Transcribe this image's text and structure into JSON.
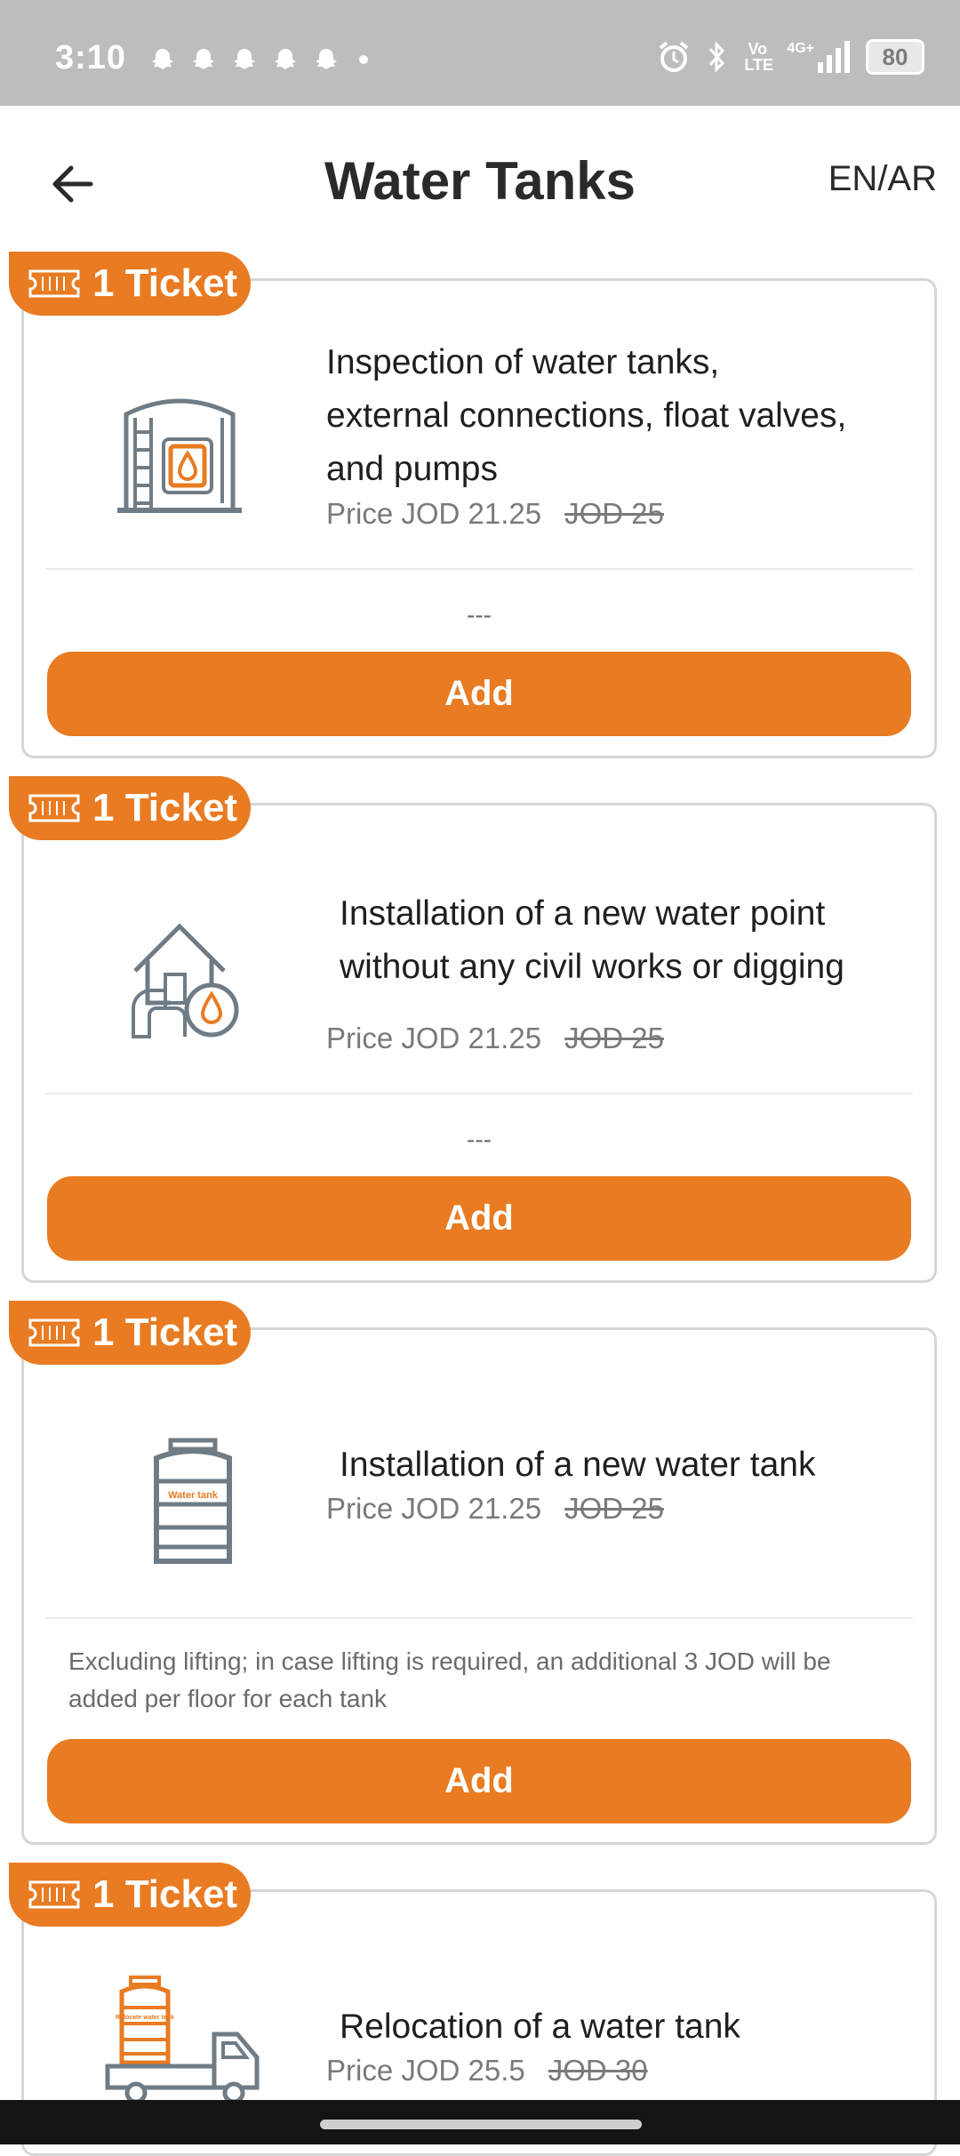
{
  "status_bar": {
    "time": "3:10",
    "signal_label": "4G+",
    "volte_label": "Vo LTE",
    "battery": "80"
  },
  "header": {
    "title": "Water Tanks",
    "lang_toggle": "EN/AR"
  },
  "colors": {
    "accent": "#E97B22",
    "icon_gray": "#6F7C86"
  },
  "cards": [
    {
      "badge": "1 Ticket",
      "icon": "water-tank-inspection-icon",
      "title_lines": [
        "Inspection of water tanks,",
        "external connections, float valves,",
        "and pumps"
      ],
      "price": "Price JOD 21.25",
      "old_price": "JOD 25",
      "note": "---",
      "button": "Add"
    },
    {
      "badge": "1 Ticket",
      "icon": "house-water-point-icon",
      "title_lines": [
        "Installation of a new water point",
        "without any civil works or digging"
      ],
      "price": "Price JOD 21.25",
      "old_price": "JOD 25",
      "note": "---",
      "button": "Add"
    },
    {
      "badge": "1 Ticket",
      "icon": "water-tank-icon",
      "icon_text": "Water tank",
      "title_lines": [
        "Installation of a new water tank"
      ],
      "price": "Price JOD 21.25",
      "old_price": "JOD 25",
      "note": "Excluding lifting; in case lifting is required, an additional 3 JOD will be added per floor for each tank",
      "button": "Add"
    },
    {
      "badge": "1 Ticket",
      "icon": "truck-water-tank-icon",
      "icon_text": "Relocate water tank",
      "title_lines": [
        "Relocation of a water tank"
      ],
      "price": "Price JOD 25.5",
      "old_price": "JOD 30"
    }
  ]
}
